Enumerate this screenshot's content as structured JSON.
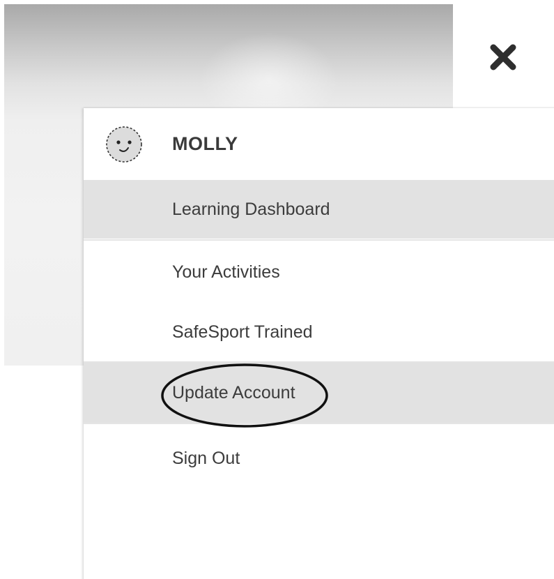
{
  "close_button": {
    "icon": "close-icon"
  },
  "menu": {
    "user": {
      "name": "MOLLY",
      "avatar_icon": "smiley-avatar-icon"
    },
    "items": [
      {
        "label": "Learning Dashboard",
        "highlighted": true
      },
      {
        "label": "Your Activities",
        "highlighted": false
      },
      {
        "label": "SafeSport Trained",
        "highlighted": false
      },
      {
        "label": "Update Account",
        "highlighted": true,
        "circled": true
      },
      {
        "label": "Sign Out",
        "highlighted": false
      }
    ]
  },
  "colors": {
    "highlight_bg": "#e2e2e2",
    "text": "#3c3c3c",
    "divider": "#e4e4e4",
    "annotation": "#111111"
  }
}
